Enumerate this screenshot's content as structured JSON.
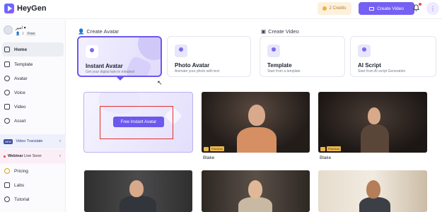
{
  "header": {
    "brand": "HeyGen",
    "credits_label": "2 Credits",
    "create_video_label": "Create Video",
    "more_label": "⋮"
  },
  "user": {
    "name": "امیر",
    "count": "1",
    "plan": "Free"
  },
  "sidebar": {
    "items": [
      {
        "label": "Home",
        "icon": "home-icon"
      },
      {
        "label": "Template",
        "icon": "template-icon"
      },
      {
        "label": "Avatar",
        "icon": "avatar-icon"
      },
      {
        "label": "Voice",
        "icon": "voice-icon"
      },
      {
        "label": "Video",
        "icon": "video-icon"
      },
      {
        "label": "Asset",
        "icon": "asset-icon"
      }
    ],
    "video_translate": {
      "tag": "NEW",
      "label": "Video Translate"
    },
    "webinar": {
      "label_bold": "Webinar",
      "label_rest": "Live Soon"
    },
    "bottom_items": [
      {
        "label": "Pricing",
        "icon": "pricing-icon"
      },
      {
        "label": "Labs",
        "icon": "labs-icon"
      },
      {
        "label": "Tutorial",
        "icon": "tutorial-icon"
      }
    ]
  },
  "sections": {
    "create_avatar": "Create Avatar",
    "create_video": "Create Video"
  },
  "cards": [
    {
      "title": "Instant Avatar",
      "subtitle": "Get your digital twin in minutes!"
    },
    {
      "title": "Photo Avatar",
      "subtitle": "Animate your photo with text"
    },
    {
      "title": "Template",
      "subtitle": "Start from a template"
    },
    {
      "title": "AI Script",
      "subtitle": "Start from AI script Generation"
    }
  ],
  "free_instant_avatar_label": "Free Instant Avatar",
  "avatars": [
    {
      "name": "Blake",
      "premium": "Premium"
    },
    {
      "name": "Blake",
      "premium": "Premium"
    }
  ],
  "colors": {
    "accent": "#7660f4",
    "highlight_box": "#e0312d"
  }
}
